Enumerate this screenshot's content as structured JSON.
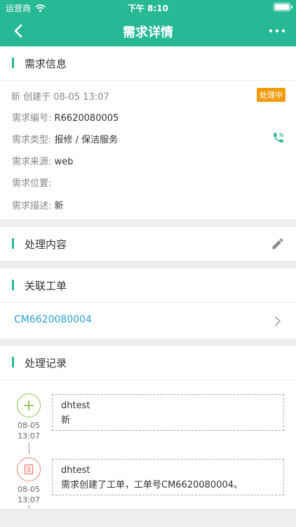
{
  "statusbar": {
    "carrier": "运营商",
    "time": "下午 8:10"
  },
  "navbar": {
    "title": "需求详情"
  },
  "info": {
    "section_title": "需求信息",
    "created": "新 创建于 08-05 13:07",
    "status": "处理中",
    "status_color": "#f39c12",
    "fields": {
      "number": {
        "label": "需求编号:",
        "value": "R6620080005"
      },
      "type": {
        "label": "需求类型:",
        "value": "报修 / 保洁服务"
      },
      "source": {
        "label": "需求来源:",
        "value": "web"
      },
      "location": {
        "label": "需求位置:",
        "value": ""
      },
      "desc": {
        "label": "需求描述:",
        "value": "新"
      }
    }
  },
  "process": {
    "section_title": "处理内容"
  },
  "related": {
    "section_title": "关联工单",
    "order": "CM6620080004"
  },
  "records": {
    "section_title": "处理记录",
    "items": [
      {
        "user": "dhtest",
        "text": "新",
        "date": "08-05",
        "time": "13:07",
        "icon": "plus-icon"
      },
      {
        "user": "dhtest",
        "text": "需求创建了工单，工单号CM6620080004。",
        "date": "08-05",
        "time": "13:07",
        "icon": "document-icon"
      }
    ]
  },
  "colors": {
    "accent": "#27b994",
    "link": "#2a9fd6",
    "badge": "#f39c12"
  }
}
